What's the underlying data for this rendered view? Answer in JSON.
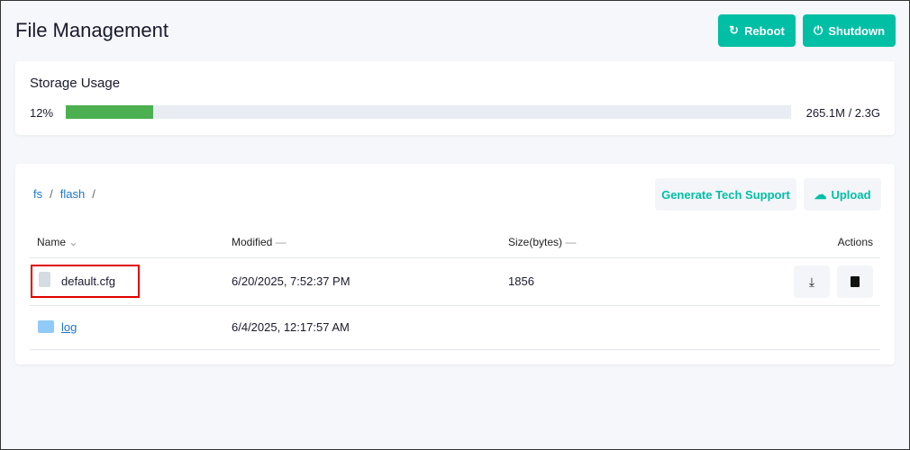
{
  "header": {
    "title": "File Management",
    "reboot": "Reboot",
    "shutdown": "Shutdown"
  },
  "storage": {
    "title": "Storage Usage",
    "percent_label": "12%",
    "percent": 12,
    "total": "265.1M / 2.3G"
  },
  "files": {
    "breadcrumb": [
      "fs",
      "flash"
    ],
    "separator": "/",
    "tech_support": "Generate Tech Support",
    "upload": "Upload",
    "columns": {
      "name": "Name",
      "modified": "Modified",
      "size": "Size(bytes)",
      "actions": "Actions"
    },
    "rows": [
      {
        "name": "default.cfg",
        "type": "file",
        "modified": "6/20/2025, 7:52:37 PM",
        "size": "1856"
      },
      {
        "name": "log",
        "type": "folder",
        "modified": "6/4/2025, 12:17:57 AM",
        "size": ""
      }
    ]
  },
  "colors": {
    "accent": "#00bfa5",
    "progress": "#4caf50",
    "highlight": "#e00000"
  }
}
